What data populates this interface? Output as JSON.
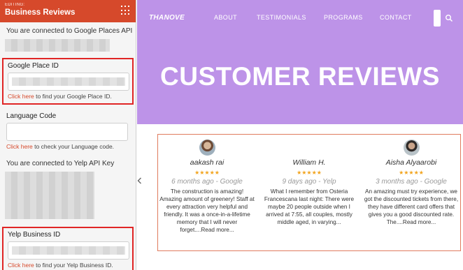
{
  "editor": {
    "editing_label": "EDITING:",
    "title": "Business Reviews",
    "google_connected": "You are connected to Google Places API",
    "google_place_id_label": "Google Place ID",
    "google_hint_link": "Click here",
    "google_hint_rest": " to find your Google Place ID.",
    "language_label": "Language Code",
    "language_hint_link": "Click here",
    "language_hint_rest": " to check your Language code.",
    "yelp_connected": "You are connected to Yelp API Key",
    "yelp_id_label": "Yelp Business ID",
    "yelp_hint_link": "Click here",
    "yelp_hint_rest": " to find your Yelp Business ID."
  },
  "site": {
    "logo": "THANOVE",
    "nav": [
      "ABOUT",
      "TESTIMONIALS",
      "PROGRAMS",
      "CONTACT"
    ],
    "hero_title": "CUSTOMER REVIEWS"
  },
  "reviews": [
    {
      "name": "aakash rai",
      "stars": "★★★★★",
      "meta": "6 months ago - Google",
      "text": "The construction is amazing! Amazing amount of greenery! Staff at every attraction very helpful and friendly. It was a once-in-a-lifetime memory that I will never forget....Read more..."
    },
    {
      "name": "William H.",
      "stars": "★★★★★",
      "meta": "9 days ago - Yelp",
      "text": "What I remember from Osteria Francescana last night: There were maybe 20 people outside when I arrived at 7:55, all couples, mostly middle aged, in varying..."
    },
    {
      "name": "Aisha Alyaarobi",
      "stars": "★★★★★",
      "meta": "3 months ago - Google",
      "text": "An amazing must try experience, we got the discounted tickets from there, they have different card offers that gives you a good discounted rate. The....Read more..."
    }
  ],
  "colors": {
    "editor_header": "#d6492b",
    "highlight_border": "#e02525",
    "hero_bg": "#bd93e8",
    "star": "#f2a31b",
    "reviews_border": "#e07b5e"
  }
}
